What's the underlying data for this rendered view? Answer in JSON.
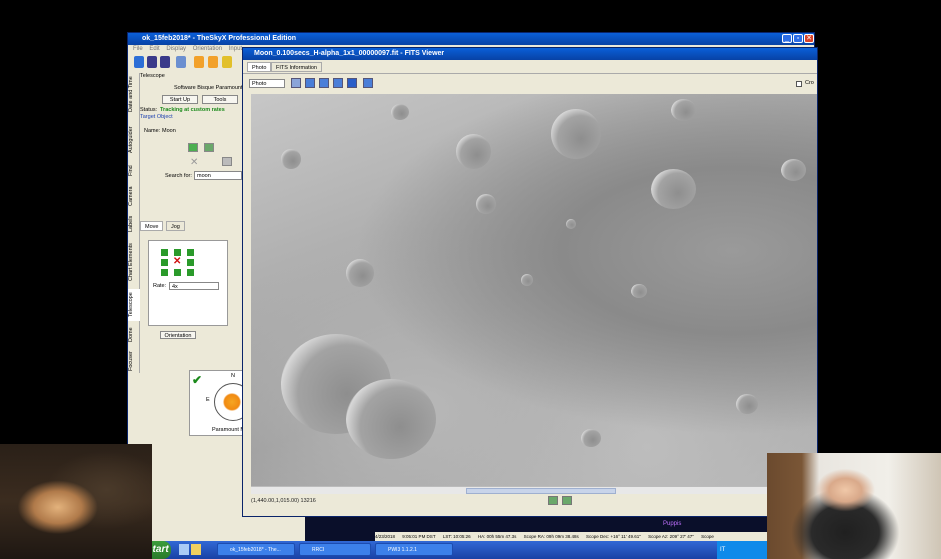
{
  "skyx": {
    "title": "ok_15feb2018* - TheSkyX Professional Edition",
    "menu": [
      "File",
      "Edit",
      "Display",
      "Orientation",
      "Input"
    ],
    "vertical_tabs": [
      "Date and Time",
      "Autoguider",
      "Find",
      "Camera",
      "Labels",
      "Chart Elements",
      "Telescope",
      "Dome",
      "Focuser"
    ],
    "telescope": {
      "header": "Telescope",
      "mount": "Software Bisque Paramount ME",
      "startup_label": "Start Up",
      "tools_label": "Tools",
      "status_label": "Status:",
      "status_value": "Tracking at custom rates",
      "target_label": "Target Object",
      "name_label": "Name:",
      "name_value": "Moon",
      "search_label": "Search for:",
      "search_value": "moon",
      "move_tab": "Move",
      "jog_tab": "Jog",
      "rate_label": "Rate:",
      "rate_value": "4x",
      "orientation_label": "Orientation",
      "compass_n": "N",
      "compass_e": "E",
      "compass_caption": "Paramount ME"
    }
  },
  "fits": {
    "title": "Moon_0.100secs_H-alpha_1x1_00000097.fit - FITS Viewer",
    "tabs": [
      "Photo",
      "FITS Information"
    ],
    "view_select": "Photo",
    "crop_label": "Cro",
    "coords": "(1,440.00,1,015.00) 13216"
  },
  "statusbar": {
    "items": [
      "4/23/2018",
      "9:05:01 PM DST",
      "LST: 10:05:26",
      "HA: 00h 55m 47.3s",
      "Scope RA: 09h 09m 38.48s",
      "Scope Dec: +16° 11' 49.61\"",
      "Scope Az: 209° 27' 47\"",
      "Scope"
    ],
    "sky_label": "Puppis"
  },
  "taskbar": {
    "start": "start",
    "items": [
      "ok_15feb2018* - The...",
      "RRCI",
      "PWI3 1.1.2.1"
    ],
    "tray": "IT"
  },
  "colors": {
    "title_blue": "#0a5fd8",
    "status_green": "#1b8a1b",
    "taskbar_blue": "#3168d5"
  }
}
